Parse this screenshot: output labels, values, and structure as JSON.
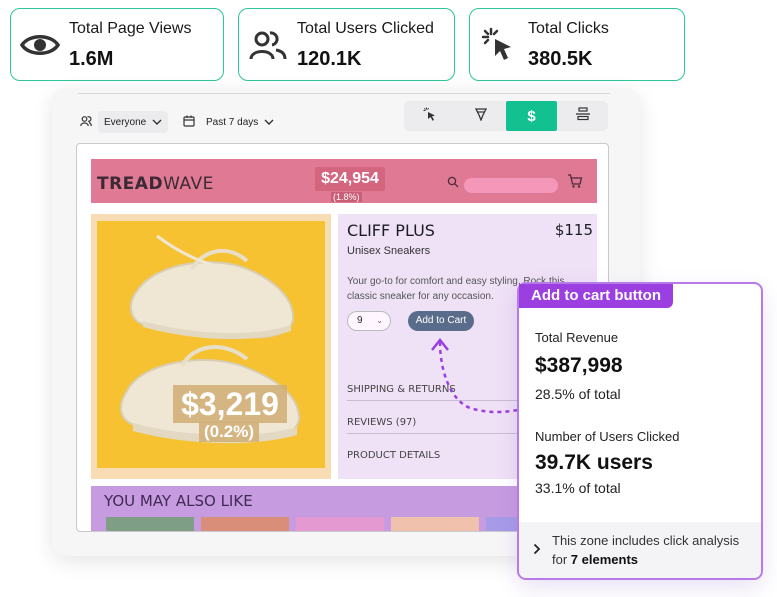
{
  "stats": [
    {
      "label": "Total Page Views",
      "value": "1.6M",
      "icon": "eye-icon"
    },
    {
      "label": "Total Users Clicked",
      "value": "120.1K",
      "icon": "users-icon"
    },
    {
      "label": "Total Clicks",
      "value": "380.5K",
      "icon": "click-cursor-icon"
    }
  ],
  "filters": {
    "segment": "Everyone",
    "period": "Past 7 days"
  },
  "toolbar": {
    "active_label": "$",
    "items": [
      "click-mode-icon",
      "heatmap-icon",
      "revenue-icon",
      "layers-icon"
    ]
  },
  "store": {
    "logo_bold": "TREAD",
    "logo_light": "WAVE",
    "header_revenue": "$24,954",
    "header_pct": "(1.8%)",
    "image_revenue": "$3,219",
    "image_pct": "(0.2%)",
    "product_name": "CLIFF PLUS",
    "product_price": "$115",
    "product_subtitle": "Unisex Sneakers",
    "product_desc": "Your go-to for comfort and easy styling. Rock this classic sneaker for any occasion.",
    "qty": "9",
    "add_to_cart": "Add to Cart",
    "accordion": [
      "SHIPPING & RETURNS",
      "REVIEWS (97)",
      "PRODUCT DETAILS"
    ],
    "also_like": "YOU MAY ALSO LIKE"
  },
  "callout": {
    "tag": "Add to cart button",
    "revenue_label": "Total Revenue",
    "revenue_value": "$387,998",
    "revenue_share": "28.5% of total",
    "users_label": "Number of Users Clicked",
    "users_value": "39.7K users",
    "users_share": "33.1% of total",
    "footer_text": "This zone includes click analysis for ",
    "footer_bold": "7 elements"
  },
  "colors": {
    "accent_green": "#13c08f",
    "callout_purple": "#9c3fe0",
    "store_header": "#e07a94",
    "product_bg": "#f6c232"
  }
}
